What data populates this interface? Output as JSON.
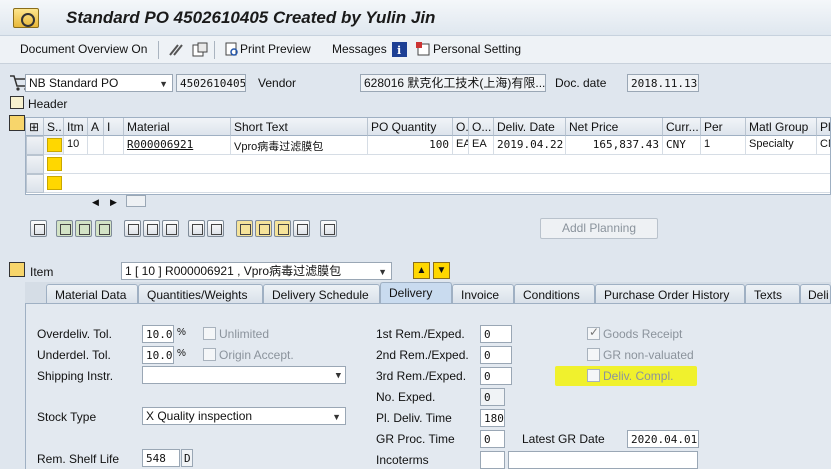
{
  "window": {
    "title": "Standard PO 4502610405 Created by Yulin Jin"
  },
  "toolbar": {
    "doc_overview": "Document Overview On",
    "print_preview": "Print Preview",
    "messages": "Messages",
    "personal_setting": "Personal Setting"
  },
  "header": {
    "po_type": "NB Standard PO",
    "po_number": "4502610405",
    "vendor_label": "Vendor",
    "vendor_value": "628016 默克化工技术(上海)有限...",
    "doc_date_label": "Doc. date",
    "doc_date_value": "2018.11.13",
    "header_label": "Header"
  },
  "items_table": {
    "columns": [
      "S..",
      "Itm",
      "A",
      "I",
      "Material",
      "Short Text",
      "PO Quantity",
      "O.",
      "O...",
      "Deliv. Date",
      "Net Price",
      "Curr...",
      "Per",
      "Matl Group",
      "Pl"
    ],
    "rows": [
      {
        "itm": "10",
        "material": "R000006921",
        "short_text": "Vpro病毒过滤膜包",
        "qty": "100",
        "o1": "EA",
        "o2": "EA",
        "deliv_date": "2019.04.22",
        "net_price": "165,837.43",
        "curr": "CNY",
        "per": "1",
        "matl_group": "Specialty",
        "plant": "CN"
      }
    ]
  },
  "addl_planning": "Addl Planning",
  "item_section": {
    "label": "Item",
    "selected_item": "1 [ 10 ] R000006921 , Vpro病毒过滤膜包"
  },
  "tabs": [
    "Material Data",
    "Quantities/Weights",
    "Delivery Schedule",
    "Delivery",
    "Invoice",
    "Conditions",
    "Purchase Order History",
    "Texts",
    "Deli"
  ],
  "active_tab": "Delivery",
  "delivery": {
    "overdeliv_label": "Overdeliv. Tol.",
    "overdeliv_value": "10.0",
    "underdel_label": "Underdel. Tol.",
    "underdel_value": "10.0",
    "percent": "%",
    "unlimited_label": "Unlimited",
    "origin_accept_label": "Origin Accept.",
    "shipping_label": "Shipping Instr.",
    "shipping_value": "",
    "stock_type_label": "Stock Type",
    "stock_type_value": "X Quality inspection",
    "shelf_life_label": "Rem. Shelf Life",
    "shelf_life_value": "548",
    "shelf_life_unit": "D",
    "rem1_label": "1st Rem./Exped.",
    "rem1_value": "0",
    "rem2_label": "2nd Rem./Exped.",
    "rem2_value": "0",
    "rem3_label": "3rd Rem./Exped.",
    "rem3_value": "0",
    "no_exped_label": "No. Exped.",
    "no_exped_value": "0",
    "pl_deliv_label": "Pl. Deliv. Time",
    "pl_deliv_value": "180",
    "gr_proc_label": "GR Proc. Time",
    "gr_proc_value": "0",
    "incoterms_label": "Incoterms",
    "goods_receipt_label": "Goods Receipt",
    "gr_nonvalued_label": "GR non-valuated",
    "deliv_compl_label": "Deliv. Compl.",
    "latest_gr_label": "Latest GR Date",
    "latest_gr_value": "2020.04.01"
  },
  "colors": {
    "highlight": "#f2f20a",
    "active_tab": "#c9dbef",
    "tab_bar": "#d8e0e9"
  }
}
